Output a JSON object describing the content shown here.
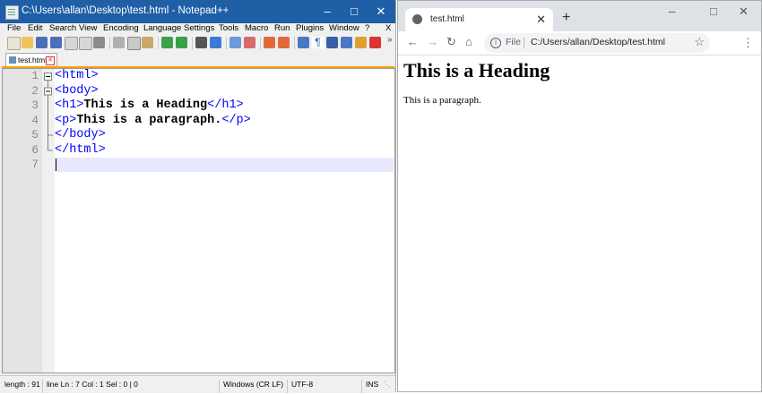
{
  "notepad": {
    "title": "C:\\Users\\allan\\Desktop\\test.html - Notepad++",
    "menu": [
      "File",
      "Edit",
      "Search",
      "View",
      "Encoding",
      "Language",
      "Settings",
      "Tools",
      "Macro",
      "Run",
      "Plugins",
      "Window",
      "?",
      "X"
    ],
    "tab_label": "test.html",
    "line_numbers": [
      "1",
      "2",
      "3",
      "4",
      "5",
      "6",
      "7"
    ],
    "code": {
      "l1": "<html>",
      "l2": "<body>",
      "l3_open": "<h1>",
      "l3_text": "This is a Heading",
      "l3_close": "</h1>",
      "l4_open": "<p>",
      "l4_text": "This is a paragraph.",
      "l4_close": "</p>",
      "l5": "</body>",
      "l6": "</html>"
    },
    "status": {
      "length": "length : 91",
      "position": "line  Ln : 7    Col : 1    Sel : 0 | 0",
      "eol": "Windows (CR LF)",
      "encoding": "UTF-8",
      "mode": "INS"
    }
  },
  "browser": {
    "tab_title": "test.html",
    "omnibox_scheme": "File",
    "url": "C:/Users/allan/Desktop/test.html",
    "page_heading": "This is a Heading",
    "page_paragraph": "This is a paragraph."
  },
  "colors": {
    "npp_titlebar": "#1f5fa6",
    "tag_color": "#0000ff",
    "current_line": "#e8e8ff",
    "tab_accent": "#f6a000"
  }
}
